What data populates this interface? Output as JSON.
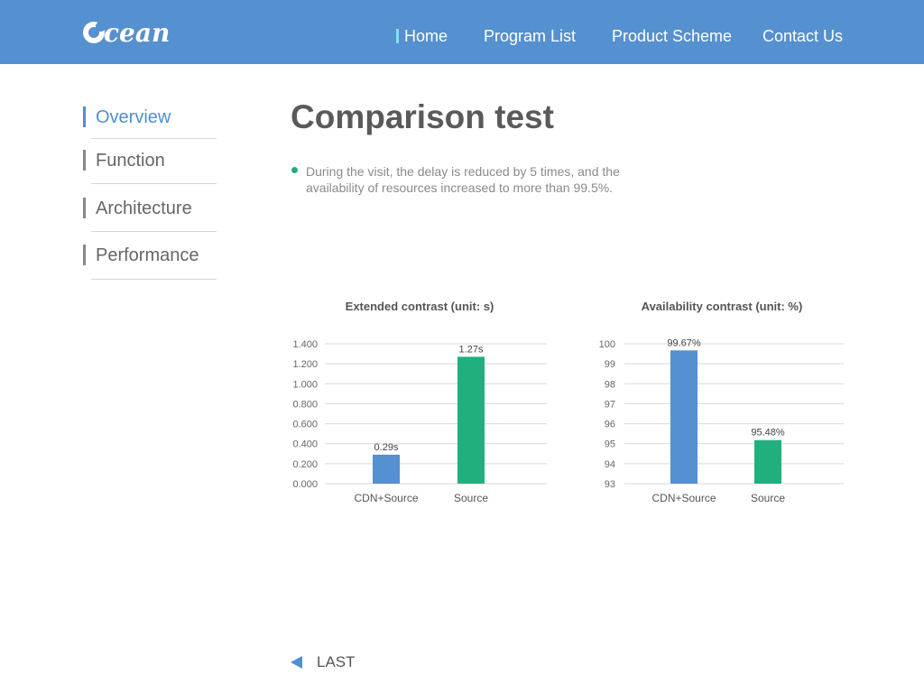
{
  "header": {
    "logo_text": "cean",
    "nav": [
      {
        "label": "Home"
      },
      {
        "label": "Program List"
      },
      {
        "label": "Product Scheme"
      },
      {
        "label": "Contact Us"
      }
    ]
  },
  "sidebar": {
    "items": [
      {
        "label": "Overview"
      },
      {
        "label": "Function"
      },
      {
        "label": "Architecture"
      },
      {
        "label": "Performance"
      }
    ]
  },
  "main": {
    "title": "Comparison test",
    "bullet": "During the visit, the delay is reduced by 5 times, and the availability of resources increased to more than 99.5%.",
    "last_label": "LAST"
  },
  "colors": {
    "header_bg": "#5590d0",
    "accent": "#4f8fd2",
    "bar_blue": "#5590d0",
    "bar_green": "#20b07e",
    "gridline": "#d9d9d9"
  },
  "icons": {
    "logo": "ocean-logo-icon",
    "back": "triangle-left-icon"
  },
  "chart_data": [
    {
      "type": "bar",
      "title": "Extended contrast (unit: s)",
      "categories": [
        "CDN+Source",
        "Source"
      ],
      "values": [
        0.29,
        1.27
      ],
      "data_labels": [
        "0.29s",
        "1.27s"
      ],
      "bar_colors": [
        "#5590d0",
        "#20b07e"
      ],
      "yticks": [
        "0.000",
        "0.200",
        "0.400",
        "0.600",
        "0.800",
        "1.000",
        "1.200",
        "1.400"
      ],
      "ylim": [
        0,
        1.4
      ],
      "grid": true
    },
    {
      "type": "bar",
      "title": "Availability contrast (unit: %)",
      "categories": [
        "CDN+Source",
        "Source"
      ],
      "values": [
        99.67,
        95.18
      ],
      "data_labels": [
        "99.67%",
        "95.48%"
      ],
      "bar_colors": [
        "#5590d0",
        "#20b07e"
      ],
      "yticks": [
        "93",
        "94",
        "95",
        "96",
        "97",
        "98",
        "99",
        "100"
      ],
      "ylim": [
        93,
        100
      ],
      "grid": true
    }
  ]
}
